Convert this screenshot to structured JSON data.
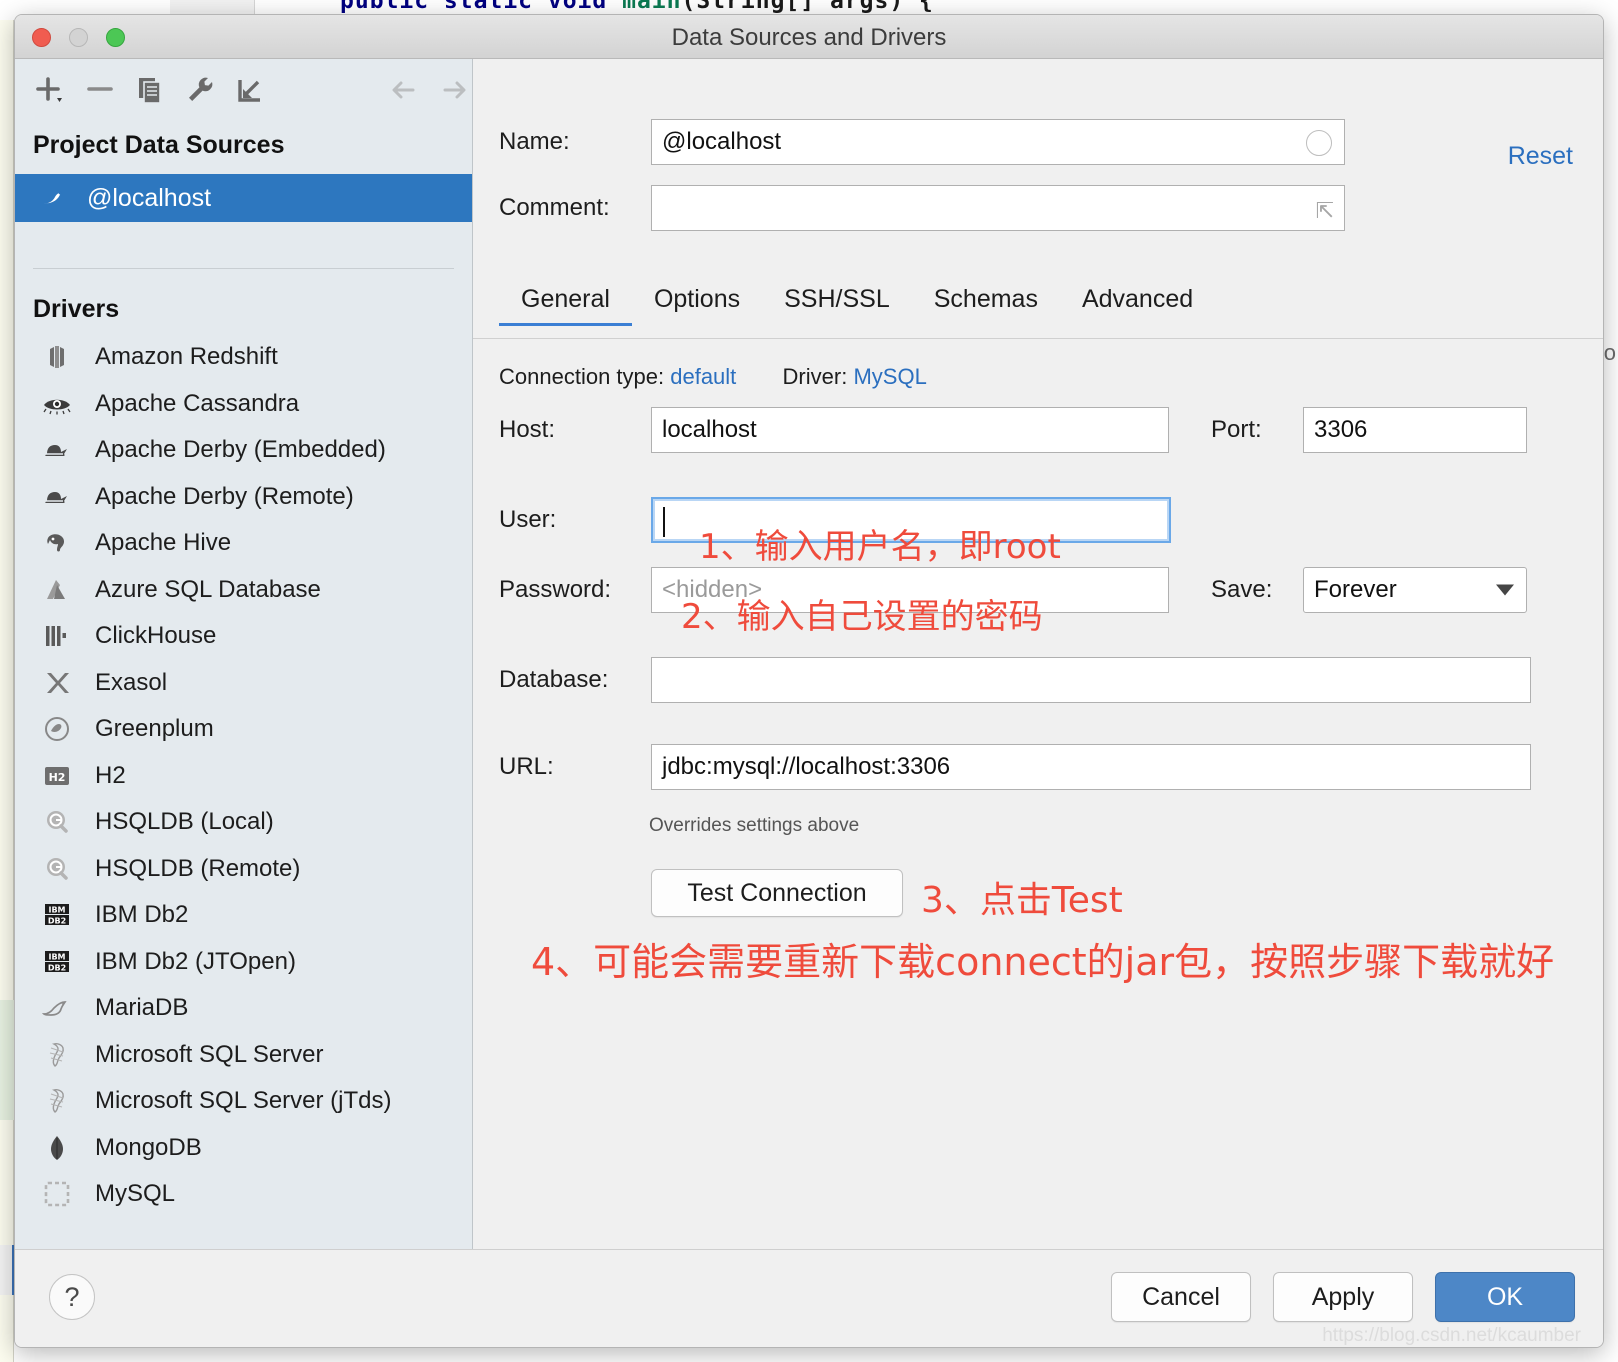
{
  "background": {
    "code_keyword": "public static void",
    "code_method": "main",
    "code_rest": "(String[] args) {",
    "side_text": "to"
  },
  "window": {
    "title": "Data Sources and Drivers",
    "controls": {
      "close": "",
      "minimize": "",
      "maximize": ""
    }
  },
  "left_pane": {
    "toolbar": [
      {
        "name": "add-data-source-button",
        "icon": "plus-icon"
      },
      {
        "name": "remove-data-source-button",
        "icon": "minus-icon"
      },
      {
        "name": "duplicate-data-source-button",
        "icon": "copy-icon"
      },
      {
        "name": "driver-properties-button",
        "icon": "wrench-icon"
      },
      {
        "name": "import-data-sources-button",
        "icon": "import-arrow-icon"
      },
      {
        "name": "navigate-back-button",
        "icon": "arrow-left-icon"
      },
      {
        "name": "navigate-forward-button",
        "icon": "arrow-right-icon"
      }
    ],
    "project_data_sources_header": "Project Data Sources",
    "selected_data_source": {
      "label": "@localhost",
      "icon": "mysql-dolphin-icon"
    },
    "drivers_header": "Drivers",
    "drivers": [
      {
        "label": "Amazon Redshift",
        "icon": "redshift-icon"
      },
      {
        "label": "Apache Cassandra",
        "icon": "cassandra-eye-icon"
      },
      {
        "label": "Apache Derby (Embedded)",
        "icon": "derby-hat-icon"
      },
      {
        "label": "Apache Derby (Remote)",
        "icon": "derby-hat-icon"
      },
      {
        "label": "Apache Hive",
        "icon": "hive-elephant-icon"
      },
      {
        "label": "Azure SQL Database",
        "icon": "azure-icon"
      },
      {
        "label": "ClickHouse",
        "icon": "clickhouse-bars-icon"
      },
      {
        "label": "Exasol",
        "icon": "exasol-x-icon"
      },
      {
        "label": "Greenplum",
        "icon": "greenplum-circle-icon"
      },
      {
        "label": "H2",
        "icon": "h2-icon"
      },
      {
        "label": "HSQLDB (Local)",
        "icon": "hsqldb-icon"
      },
      {
        "label": "HSQLDB (Remote)",
        "icon": "hsqldb-icon"
      },
      {
        "label": "IBM Db2",
        "icon": "ibm-db2-icon"
      },
      {
        "label": "IBM Db2 (JTOpen)",
        "icon": "ibm-db2-icon"
      },
      {
        "label": "MariaDB",
        "icon": "mariadb-seal-icon"
      },
      {
        "label": "Microsoft SQL Server",
        "icon": "mssql-icon"
      },
      {
        "label": "Microsoft SQL Server (jTds)",
        "icon": "mssql-icon"
      },
      {
        "label": "MongoDB",
        "icon": "mongodb-leaf-icon"
      },
      {
        "label": "MySQL",
        "icon": "mysql-icon"
      }
    ]
  },
  "details": {
    "name_label": "Name:",
    "name_value": "@localhost",
    "comment_label": "Comment:",
    "comment_value": "",
    "comment_placeholder": "",
    "reset_label": "Reset",
    "tabs": [
      {
        "label": "General",
        "active": true
      },
      {
        "label": "Options",
        "active": false
      },
      {
        "label": "SSH/SSL",
        "active": false
      },
      {
        "label": "Schemas",
        "active": false
      },
      {
        "label": "Advanced",
        "active": false
      }
    ],
    "connection_type_label": "Connection type:",
    "connection_type_value": "default",
    "driver_label": "Driver:",
    "driver_value": "MySQL",
    "host_label": "Host:",
    "host_value": "localhost",
    "port_label": "Port:",
    "port_value": "3306",
    "user_label": "User:",
    "user_value": "",
    "password_label": "Password:",
    "password_placeholder": "<hidden>",
    "save_label": "Save:",
    "save_value": "Forever",
    "database_label": "Database:",
    "database_value": "",
    "url_label": "URL:",
    "url_value": "jdbc:mysql://localhost:3306",
    "overrides_note": "Overrides settings above",
    "test_connection_label": "Test Connection"
  },
  "annotations": {
    "color": "#ef4b3c",
    "step1": "1、输入用户名，即root",
    "step2": "2、输入自己设置的密码",
    "step3": "3、点击Test",
    "step4": "4、可能会需要重新下载connect的jar包，按照步骤下载就好"
  },
  "footer": {
    "help_label": "?",
    "cancel_label": "Cancel",
    "apply_label": "Apply",
    "ok_label": "OK",
    "watermark": "https://blog.csdn.net/kcaumber"
  }
}
